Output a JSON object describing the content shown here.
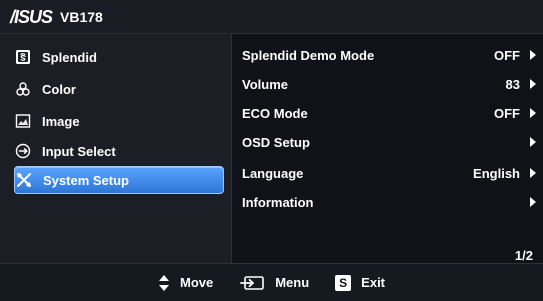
{
  "header": {
    "brand": "/ISUS",
    "model": "VB178"
  },
  "left_menu": {
    "items": [
      {
        "label": "Splendid",
        "icon": "splendid-icon",
        "selected": false
      },
      {
        "label": "Color",
        "icon": "color-icon",
        "selected": false
      },
      {
        "label": "Image",
        "icon": "image-icon",
        "selected": false
      },
      {
        "label": "Input Select",
        "icon": "input-select-icon",
        "selected": false
      },
      {
        "label": "System Setup",
        "icon": "system-setup-icon",
        "selected": true
      }
    ]
  },
  "right_menu": {
    "rows": [
      {
        "label": "Splendid Demo Mode",
        "value": "OFF"
      },
      {
        "label": "Volume",
        "value": "83"
      },
      {
        "label": "ECO Mode",
        "value": "OFF"
      },
      {
        "label": "OSD Setup",
        "value": ""
      },
      {
        "label": "Language",
        "value": "English"
      },
      {
        "label": "Information",
        "value": ""
      }
    ],
    "page": "1/2"
  },
  "footer": {
    "move_label": "Move",
    "menu_label": "Menu",
    "exit_label": "Exit",
    "exit_badge": "S"
  },
  "colors": {
    "selected_gradient_top": "#5aa4ff",
    "selected_gradient_bottom": "#2e76d4"
  }
}
